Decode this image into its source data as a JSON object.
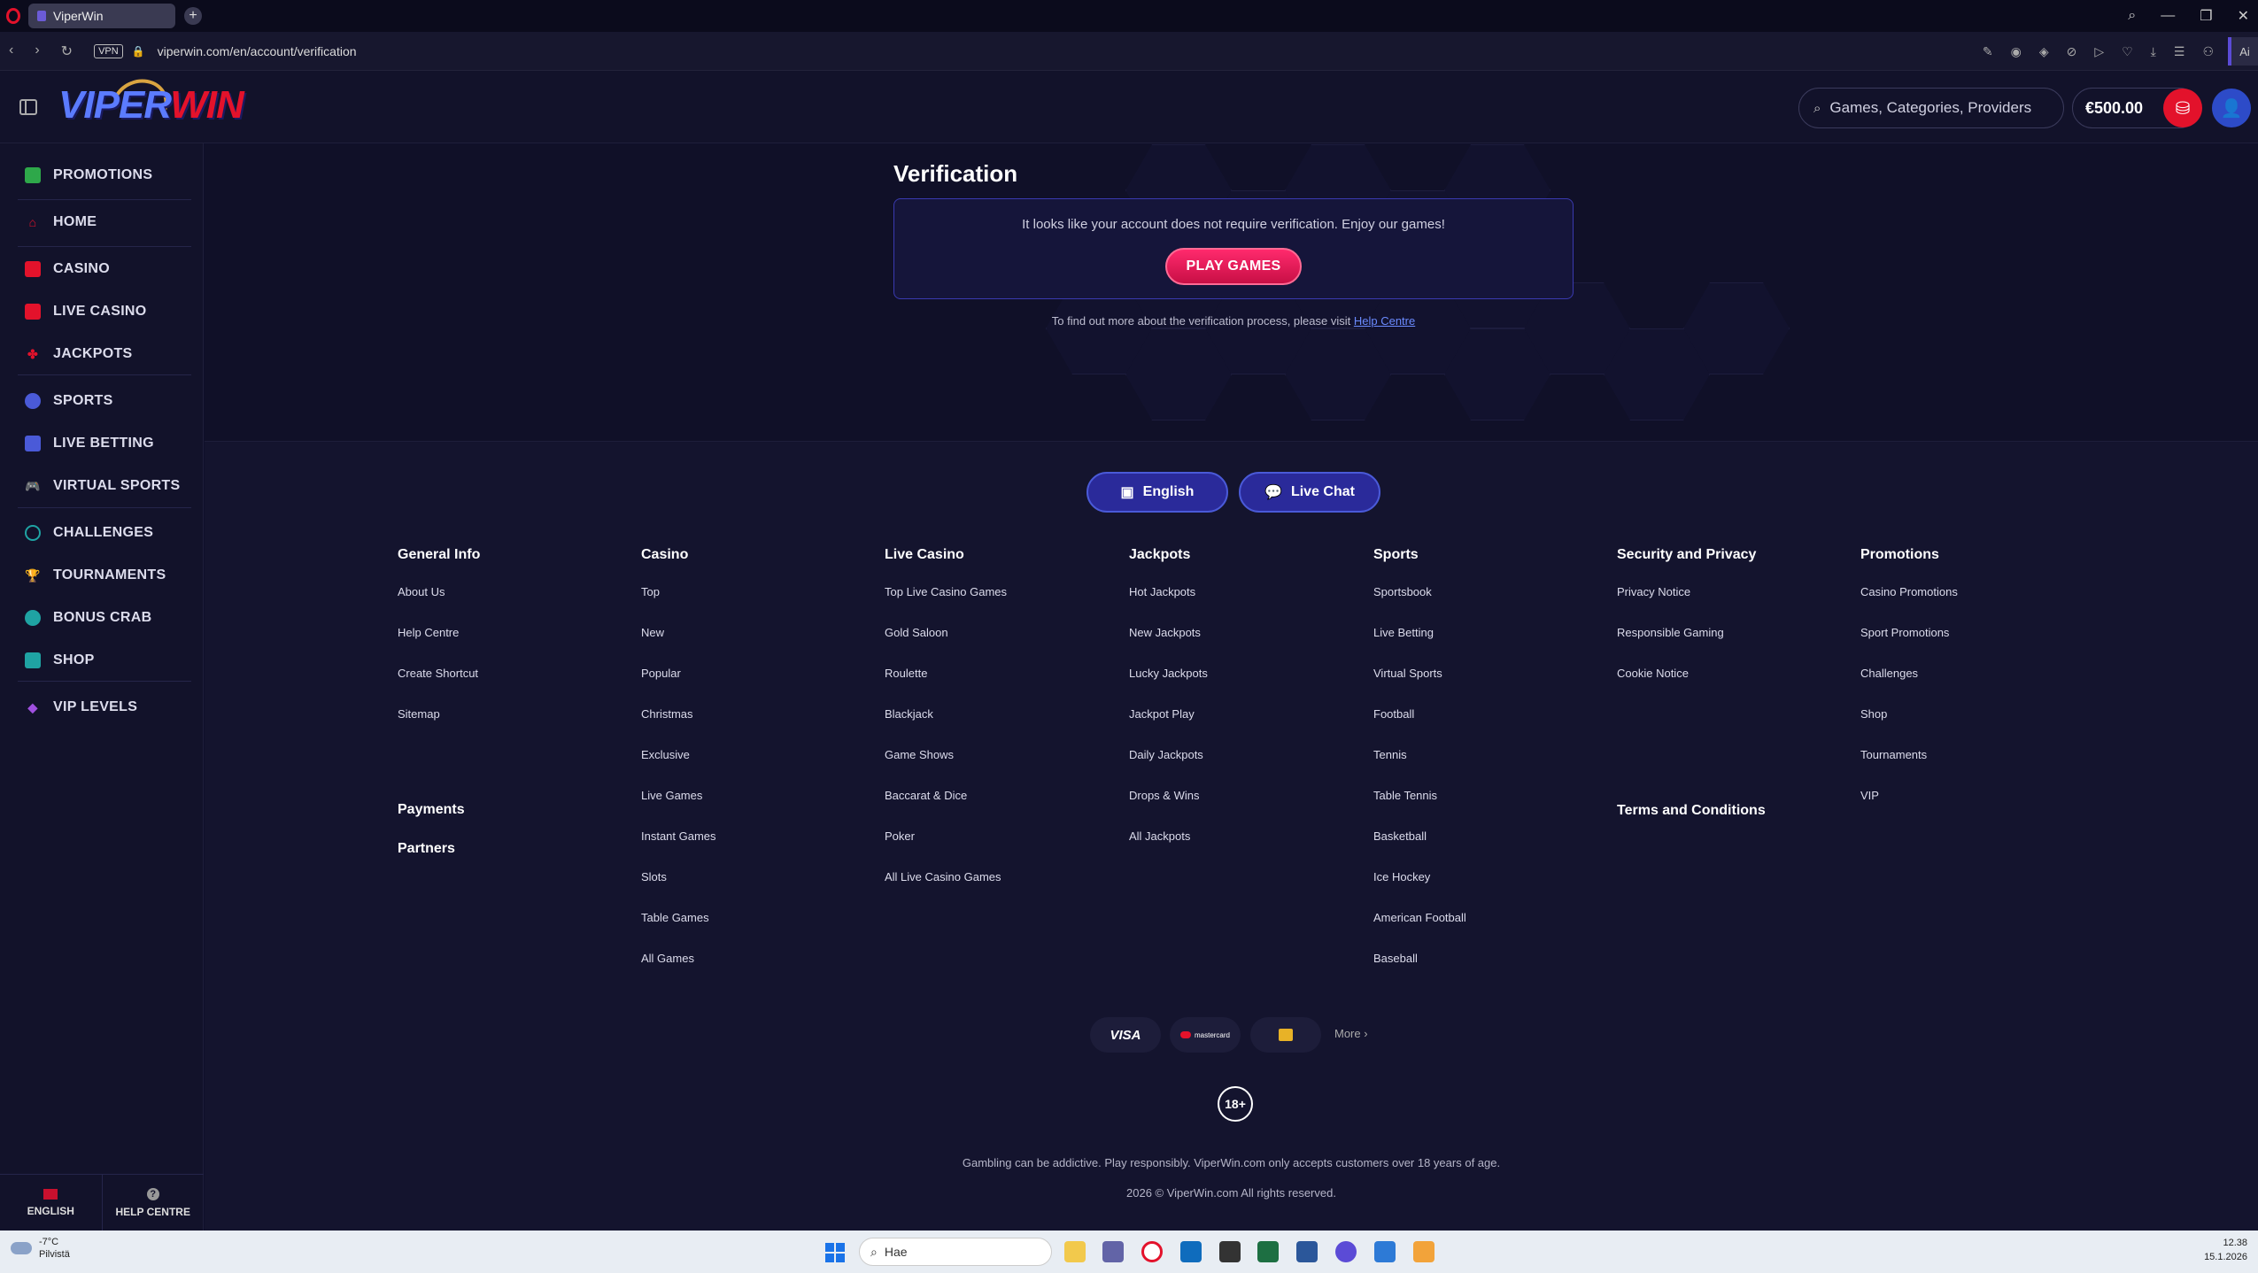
{
  "browser": {
    "tab_title": "ViperWin",
    "new_tab": "+",
    "vpn": "VPN",
    "url": "viperwin.com/en/account/verification",
    "right_label": "Ai"
  },
  "header": {
    "logo_viper": "VIPER",
    "logo_win": "WIN",
    "search_placeholder": "Games, Categories, Providers",
    "balance": "€500.00"
  },
  "sidebar": {
    "items": [
      {
        "label": "PROMOTIONS",
        "icon": "gift-icon",
        "color": "#2ea84a"
      },
      {
        "label": "HOME",
        "icon": "home-icon",
        "color": "#e3122b"
      },
      {
        "label": "CASINO",
        "icon": "slot-icon",
        "color": "#e3122b"
      },
      {
        "label": "LIVE CASINO",
        "icon": "card-icon",
        "color": "#e3122b"
      },
      {
        "label": "JACKPOTS",
        "icon": "clover-icon",
        "color": "#e3122b"
      },
      {
        "label": "SPORTS",
        "icon": "ball-icon",
        "color": "#4a5ad8"
      },
      {
        "label": "LIVE BETTING",
        "icon": "chart-icon",
        "color": "#4a5ad8"
      },
      {
        "label": "VIRTUAL SPORTS",
        "icon": "gamepad-icon",
        "color": "#4a5ad8"
      },
      {
        "label": "CHALLENGES",
        "icon": "target-icon",
        "color": "#1fa3a3"
      },
      {
        "label": "TOURNAMENTS",
        "icon": "trophy-icon",
        "color": "#1fa3a3"
      },
      {
        "label": "BONUS CRAB",
        "icon": "crab-icon",
        "color": "#1fa3a3"
      },
      {
        "label": "SHOP",
        "icon": "shop-icon",
        "color": "#1fa3a3"
      },
      {
        "label": "VIP LEVELS",
        "icon": "diamond-icon",
        "color": "#a050e0"
      }
    ],
    "footer_language": "ENGLISH",
    "footer_help": "HELP CENTRE"
  },
  "verification": {
    "title": "Verification",
    "message": "It looks like your account does not require verification. Enjoy our games!",
    "play_button": "PLAY GAMES",
    "info_text": "To find out more about the verification process, please visit",
    "info_link": "Help Centre"
  },
  "footer": {
    "language_button": "English",
    "live_chat_button": "Live Chat",
    "columns": [
      {
        "title": "General Info",
        "links": [
          "About Us",
          "Help Centre",
          "Create Shortcut",
          "Sitemap"
        ]
      },
      {
        "title": "Casino",
        "links": [
          "Top",
          "New",
          "Popular",
          "Christmas",
          "Exclusive",
          "Live Games",
          "Instant Games",
          "Slots",
          "Table Games",
          "All Games"
        ]
      },
      {
        "title": "Live Casino",
        "links": [
          "Top Live Casino Games",
          "Gold Saloon",
          "Roulette",
          "Blackjack",
          "Game Shows",
          "Baccarat & Dice",
          "Poker",
          "All Live Casino Games"
        ]
      },
      {
        "title": "Jackpots",
        "links": [
          "Hot Jackpots",
          "New Jackpots",
          "Lucky Jackpots",
          "Jackpot Play",
          "Daily Jackpots",
          "Drops & Wins",
          "All Jackpots"
        ]
      },
      {
        "title": "Sports",
        "links": [
          "Sportsbook",
          "Live Betting",
          "Virtual Sports",
          "Football",
          "Tennis",
          "Table Tennis",
          "Basketball",
          "Ice Hockey",
          "American Football",
          "Baseball"
        ]
      },
      {
        "title": "Security and Privacy",
        "links": [
          "Privacy Notice",
          "Responsible Gaming",
          "Cookie Notice"
        ]
      },
      {
        "title": "Promotions",
        "links": [
          "Casino Promotions",
          "Sport Promotions",
          "Challenges",
          "Shop",
          "Tournaments",
          "VIP"
        ]
      }
    ],
    "payments": "Payments",
    "partners": "Partners",
    "terms": "Terms and Conditions",
    "pay_visa": "VISA",
    "pay_mastercard": "mastercard",
    "more": "More",
    "age": "18+",
    "disclaimer": "Gambling can be addictive. Play responsibly. ViperWin.com only accepts customers over 18 years of age.",
    "copyright": "2026 © ViperWin.com All rights reserved."
  },
  "taskbar": {
    "temperature": "-7°C",
    "weather": "Pilvistä",
    "search": "Hae",
    "time": "12.38",
    "date": "15.1.2026"
  }
}
